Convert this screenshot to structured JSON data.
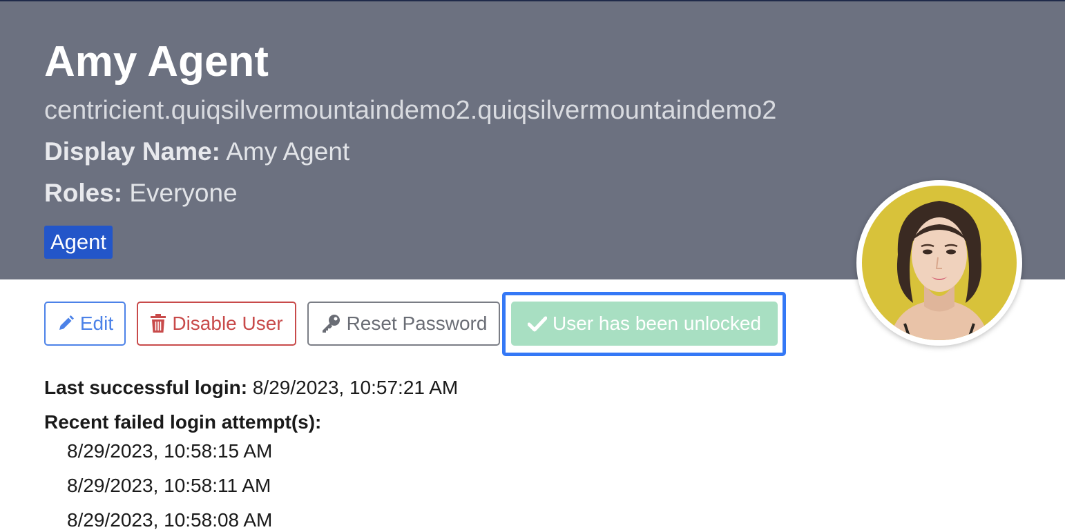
{
  "user": {
    "name": "Amy Agent",
    "username": "centricient.quiqsilvermountaindemo2.quiqsilvermountaindemo2",
    "display_name_label": "Display Name:",
    "display_name": "Amy Agent",
    "roles_label": "Roles:",
    "roles": "Everyone",
    "badge": "Agent"
  },
  "actions": {
    "edit_label": "Edit",
    "disable_label": "Disable User",
    "reset_label": "Reset Password",
    "unlocked_label": "User has been unlocked"
  },
  "login": {
    "last_success_label": "Last successful login:",
    "last_success_value": "8/29/2023, 10:57:21 AM",
    "failed_title": "Recent failed login attempt(s):",
    "failed_attempts": [
      "8/29/2023, 10:58:15 AM",
      "8/29/2023, 10:58:11 AM",
      "8/29/2023, 10:58:08 AM"
    ]
  },
  "colors": {
    "header_bg": "#6c7180",
    "badge_bg": "#2356c9",
    "edit": "#4c82e8",
    "disable": "#c84a4a",
    "reset": "#7a7d85",
    "unlocked_bg": "#a8dfc2",
    "focus_ring": "#3478f6"
  },
  "icons": {
    "edit": "pencil-icon",
    "disable": "trash-icon",
    "reset": "key-icon",
    "unlocked": "check-icon"
  }
}
